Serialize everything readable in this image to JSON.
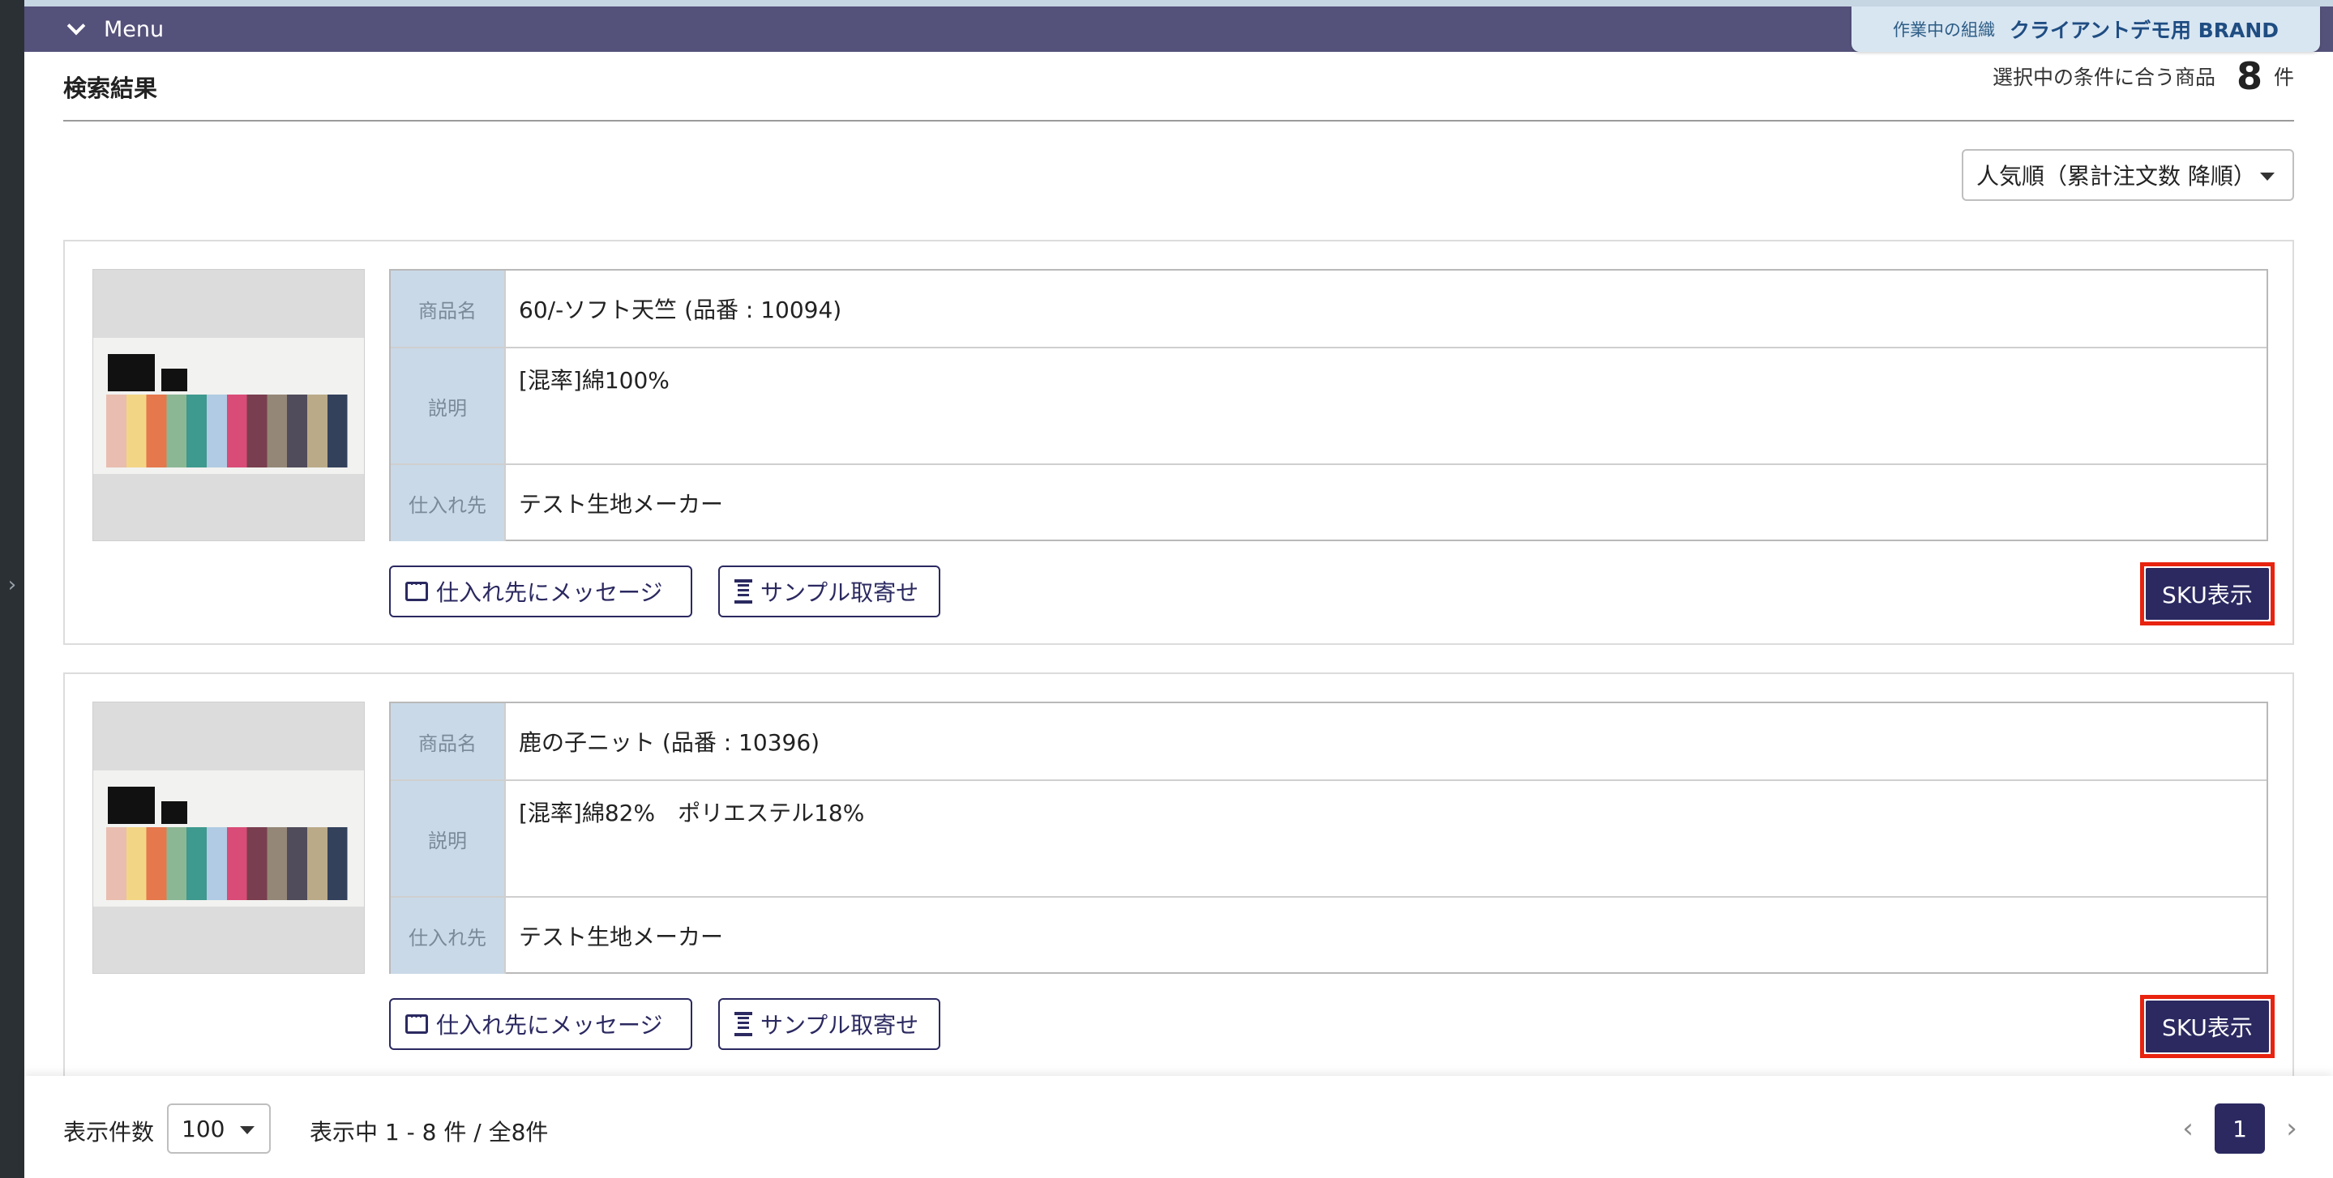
{
  "app": {
    "menu_label": "Menu",
    "org_label": "作業中の組織",
    "org_name": "クライアントデモ用 BRAND"
  },
  "results": {
    "title": "検索結果",
    "count_label": "選択中の条件に合う商品",
    "count": "8",
    "count_unit": "件",
    "sort_selected": "人気順（累計注文数 降順）"
  },
  "products": [
    {
      "name_label": "商品名",
      "name": "60/-ソフト天竺 (品番 : 10094)",
      "desc_label": "説明",
      "description": "[混率]綿100%",
      "supplier_label": "仕入れ先",
      "supplier": "テスト生地メーカー",
      "message_button": "仕入れ先にメッセージ",
      "sample_button": "サンプル取寄せ",
      "sku_button": "SKU表示"
    },
    {
      "name_label": "商品名",
      "name": "鹿の子ニット (品番 : 10396)",
      "desc_label": "説明",
      "description": "[混率]綿82%　ポリエステル18%",
      "supplier_label": "仕入れ先",
      "supplier": "テスト生地メーカー",
      "message_button": "仕入れ先にメッセージ",
      "sample_button": "サンプル取寄せ",
      "sku_button": "SKU表示"
    }
  ],
  "footer": {
    "per_page_label": "表示件数",
    "per_page_value": "100",
    "range_text": "表示中 1 - 8 件 / 全8件",
    "prev_arrow": "‹",
    "current_page": "1",
    "next_arrow": "›"
  },
  "colors": {
    "menu_bar": "#54517a",
    "primary": "#2b2960",
    "highlight": "#e8230f",
    "table_header": "#c9d9e8"
  }
}
